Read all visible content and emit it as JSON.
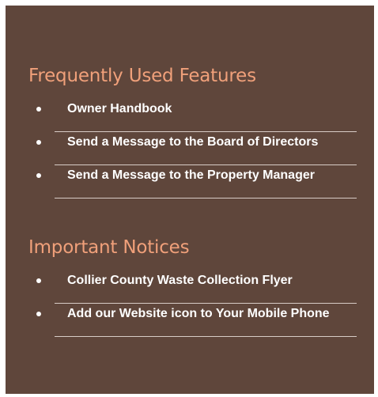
{
  "sections": [
    {
      "title": "Frequently Used Features",
      "items": [
        {
          "label": "Owner Handbook"
        },
        {
          "label": "Send a Message to the Board of Directors"
        },
        {
          "label": "Send a Message to the Property Manager"
        }
      ]
    },
    {
      "title": "Important Notices",
      "items": [
        {
          "label": "Collier County Waste Collection Flyer"
        },
        {
          "label": "Add our Website icon to Your Mobile Phone"
        }
      ]
    }
  ],
  "colors": {
    "panel_background": "#5f463b",
    "heading": "#f0a07a",
    "link_text": "#ffffff",
    "divider": "#d8ccc6"
  }
}
